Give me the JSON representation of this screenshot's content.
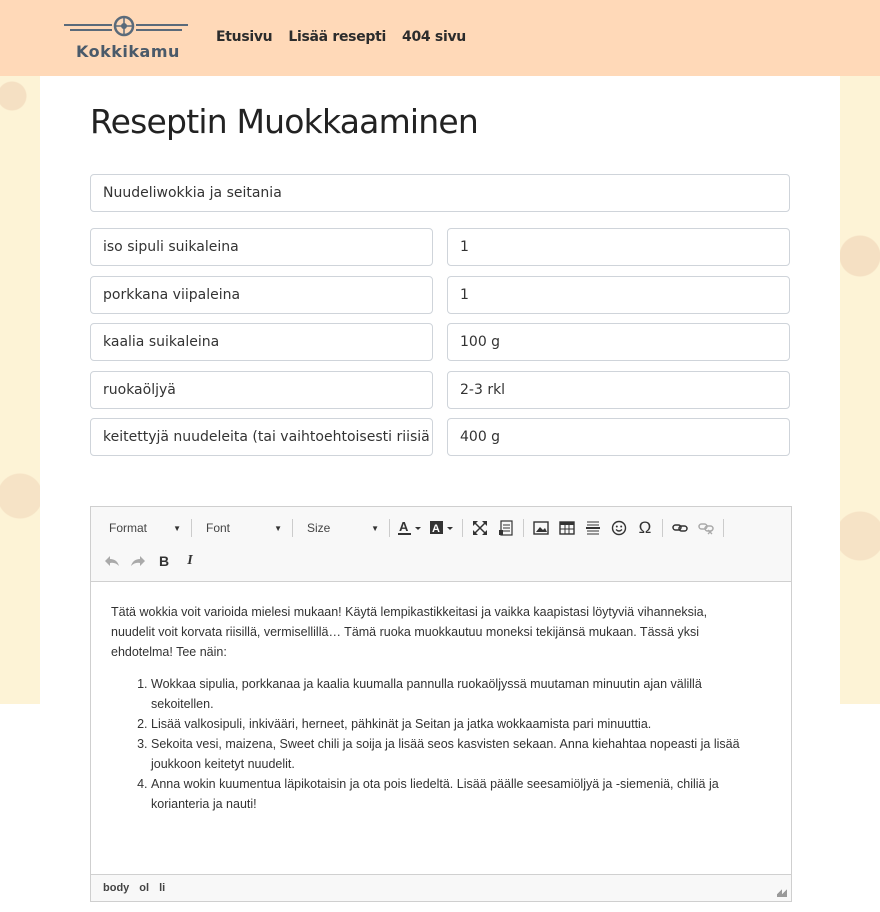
{
  "brand": {
    "name": "Kokkikamu"
  },
  "nav": [
    "Etusivu",
    "Lisää resepti",
    "404 sivu"
  ],
  "page": {
    "title": "Reseptin Muokkaaminen"
  },
  "recipe": {
    "name": "Nuudeliwokkia ja seitania",
    "ingredients": [
      {
        "name": "iso sipuli suikaleina",
        "amount": "1"
      },
      {
        "name": "porkkana viipaleina",
        "amount": "1"
      },
      {
        "name": "kaalia suikaleina",
        "amount": "100 g"
      },
      {
        "name": "ruokaöljyä",
        "amount": "2-3 rkl"
      },
      {
        "name": "keitettyjä nuudeleita (tai vaihtoehtoisesti riisiä",
        "amount": "400 g"
      }
    ]
  },
  "editor": {
    "toolbar": {
      "format": "Format",
      "font": "Font",
      "size": "Size",
      "bold": "B",
      "italic": "I",
      "omega": "Ω"
    },
    "intro": "Tätä wokkia voit varioida mielesi mukaan! Käytä lempikastikkeitasi ja vaikka kaapistasi löytyviä vihanneksia, nuudelit voit korvata riisillä, vermisellillä… Tämä ruoka muokkautuu moneksi tekijänsä mukaan. Tässä yksi ehdotelma! Tee näin:",
    "steps": [
      "Wokkaa sipulia, porkkanaa ja kaalia kuumalla pannulla ruokaöljyssä muutaman minuutin ajan välillä sekoitellen.",
      "Lisää valkosipuli, inkivääri, herneet, pähkinät ja Seitan ja jatka wokkaamista pari minuuttia.",
      "Sekoita vesi, maizena, Sweet chili ja soija ja lisää seos kasvisten sekaan. Anna kiehahtaa nopeasti ja lisää joukkoon keitetyt nuudelit.",
      "Anna wokin kuumentua läpikotaisin ja ota pois liedeltä. Lisää päälle  seesamiöljyä ja -siemeniä, chiliä ja korianteria ja nauti!"
    ],
    "statusbar": [
      "body",
      "ol",
      "li"
    ]
  }
}
